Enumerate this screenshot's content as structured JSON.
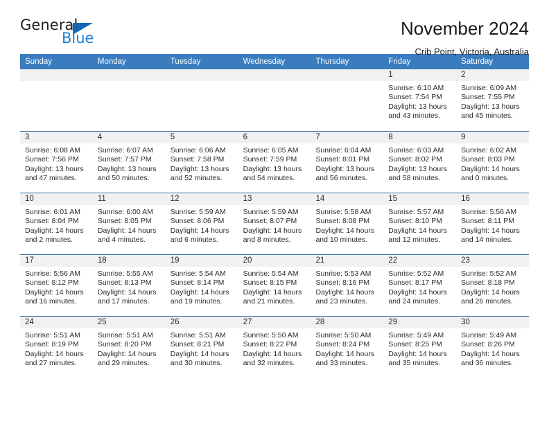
{
  "brand": {
    "name_part1": "General",
    "name_part2": "Blue",
    "triangle_color": "#1567b5",
    "blue_text_color": "#1b7fd4"
  },
  "header": {
    "title": "November 2024",
    "subtitle": "Crib Point, Victoria, Australia",
    "accent_color": "#3a7cbe"
  },
  "weekdays": [
    {
      "label": "Sunday"
    },
    {
      "label": "Monday"
    },
    {
      "label": "Tuesday"
    },
    {
      "label": "Wednesday"
    },
    {
      "label": "Thursday"
    },
    {
      "label": "Friday"
    },
    {
      "label": "Saturday"
    }
  ],
  "weeks": [
    {
      "days": [
        {
          "date": "",
          "sunrise": "",
          "sunset": "",
          "daylight": "",
          "empty": true
        },
        {
          "date": "",
          "sunrise": "",
          "sunset": "",
          "daylight": "",
          "empty": true
        },
        {
          "date": "",
          "sunrise": "",
          "sunset": "",
          "daylight": "",
          "empty": true
        },
        {
          "date": "",
          "sunrise": "",
          "sunset": "",
          "daylight": "",
          "empty": true
        },
        {
          "date": "",
          "sunrise": "",
          "sunset": "",
          "daylight": "",
          "empty": true
        },
        {
          "date": "1",
          "sunrise": "Sunrise: 6:10 AM",
          "sunset": "Sunset: 7:54 PM",
          "daylight": "Daylight: 13 hours and 43 minutes.",
          "empty": false
        },
        {
          "date": "2",
          "sunrise": "Sunrise: 6:09 AM",
          "sunset": "Sunset: 7:55 PM",
          "daylight": "Daylight: 13 hours and 45 minutes.",
          "empty": false
        }
      ]
    },
    {
      "days": [
        {
          "date": "3",
          "sunrise": "Sunrise: 6:08 AM",
          "sunset": "Sunset: 7:56 PM",
          "daylight": "Daylight: 13 hours and 47 minutes.",
          "empty": false
        },
        {
          "date": "4",
          "sunrise": "Sunrise: 6:07 AM",
          "sunset": "Sunset: 7:57 PM",
          "daylight": "Daylight: 13 hours and 50 minutes.",
          "empty": false
        },
        {
          "date": "5",
          "sunrise": "Sunrise: 6:06 AM",
          "sunset": "Sunset: 7:58 PM",
          "daylight": "Daylight: 13 hours and 52 minutes.",
          "empty": false
        },
        {
          "date": "6",
          "sunrise": "Sunrise: 6:05 AM",
          "sunset": "Sunset: 7:59 PM",
          "daylight": "Daylight: 13 hours and 54 minutes.",
          "empty": false
        },
        {
          "date": "7",
          "sunrise": "Sunrise: 6:04 AM",
          "sunset": "Sunset: 8:01 PM",
          "daylight": "Daylight: 13 hours and 56 minutes.",
          "empty": false
        },
        {
          "date": "8",
          "sunrise": "Sunrise: 6:03 AM",
          "sunset": "Sunset: 8:02 PM",
          "daylight": "Daylight: 13 hours and 58 minutes.",
          "empty": false
        },
        {
          "date": "9",
          "sunrise": "Sunrise: 6:02 AM",
          "sunset": "Sunset: 8:03 PM",
          "daylight": "Daylight: 14 hours and 0 minutes.",
          "empty": false
        }
      ]
    },
    {
      "days": [
        {
          "date": "10",
          "sunrise": "Sunrise: 6:01 AM",
          "sunset": "Sunset: 8:04 PM",
          "daylight": "Daylight: 14 hours and 2 minutes.",
          "empty": false
        },
        {
          "date": "11",
          "sunrise": "Sunrise: 6:00 AM",
          "sunset": "Sunset: 8:05 PM",
          "daylight": "Daylight: 14 hours and 4 minutes.",
          "empty": false
        },
        {
          "date": "12",
          "sunrise": "Sunrise: 5:59 AM",
          "sunset": "Sunset: 8:06 PM",
          "daylight": "Daylight: 14 hours and 6 minutes.",
          "empty": false
        },
        {
          "date": "13",
          "sunrise": "Sunrise: 5:59 AM",
          "sunset": "Sunset: 8:07 PM",
          "daylight": "Daylight: 14 hours and 8 minutes.",
          "empty": false
        },
        {
          "date": "14",
          "sunrise": "Sunrise: 5:58 AM",
          "sunset": "Sunset: 8:08 PM",
          "daylight": "Daylight: 14 hours and 10 minutes.",
          "empty": false
        },
        {
          "date": "15",
          "sunrise": "Sunrise: 5:57 AM",
          "sunset": "Sunset: 8:10 PM",
          "daylight": "Daylight: 14 hours and 12 minutes.",
          "empty": false
        },
        {
          "date": "16",
          "sunrise": "Sunrise: 5:56 AM",
          "sunset": "Sunset: 8:11 PM",
          "daylight": "Daylight: 14 hours and 14 minutes.",
          "empty": false
        }
      ]
    },
    {
      "days": [
        {
          "date": "17",
          "sunrise": "Sunrise: 5:56 AM",
          "sunset": "Sunset: 8:12 PM",
          "daylight": "Daylight: 14 hours and 16 minutes.",
          "empty": false
        },
        {
          "date": "18",
          "sunrise": "Sunrise: 5:55 AM",
          "sunset": "Sunset: 8:13 PM",
          "daylight": "Daylight: 14 hours and 17 minutes.",
          "empty": false
        },
        {
          "date": "19",
          "sunrise": "Sunrise: 5:54 AM",
          "sunset": "Sunset: 8:14 PM",
          "daylight": "Daylight: 14 hours and 19 minutes.",
          "empty": false
        },
        {
          "date": "20",
          "sunrise": "Sunrise: 5:54 AM",
          "sunset": "Sunset: 8:15 PM",
          "daylight": "Daylight: 14 hours and 21 minutes.",
          "empty": false
        },
        {
          "date": "21",
          "sunrise": "Sunrise: 5:53 AM",
          "sunset": "Sunset: 8:16 PM",
          "daylight": "Daylight: 14 hours and 23 minutes.",
          "empty": false
        },
        {
          "date": "22",
          "sunrise": "Sunrise: 5:52 AM",
          "sunset": "Sunset: 8:17 PM",
          "daylight": "Daylight: 14 hours and 24 minutes.",
          "empty": false
        },
        {
          "date": "23",
          "sunrise": "Sunrise: 5:52 AM",
          "sunset": "Sunset: 8:18 PM",
          "daylight": "Daylight: 14 hours and 26 minutes.",
          "empty": false
        }
      ]
    },
    {
      "days": [
        {
          "date": "24",
          "sunrise": "Sunrise: 5:51 AM",
          "sunset": "Sunset: 8:19 PM",
          "daylight": "Daylight: 14 hours and 27 minutes.",
          "empty": false
        },
        {
          "date": "25",
          "sunrise": "Sunrise: 5:51 AM",
          "sunset": "Sunset: 8:20 PM",
          "daylight": "Daylight: 14 hours and 29 minutes.",
          "empty": false
        },
        {
          "date": "26",
          "sunrise": "Sunrise: 5:51 AM",
          "sunset": "Sunset: 8:21 PM",
          "daylight": "Daylight: 14 hours and 30 minutes.",
          "empty": false
        },
        {
          "date": "27",
          "sunrise": "Sunrise: 5:50 AM",
          "sunset": "Sunset: 8:22 PM",
          "daylight": "Daylight: 14 hours and 32 minutes.",
          "empty": false
        },
        {
          "date": "28",
          "sunrise": "Sunrise: 5:50 AM",
          "sunset": "Sunset: 8:24 PM",
          "daylight": "Daylight: 14 hours and 33 minutes.",
          "empty": false
        },
        {
          "date": "29",
          "sunrise": "Sunrise: 5:49 AM",
          "sunset": "Sunset: 8:25 PM",
          "daylight": "Daylight: 14 hours and 35 minutes.",
          "empty": false
        },
        {
          "date": "30",
          "sunrise": "Sunrise: 5:49 AM",
          "sunset": "Sunset: 8:26 PM",
          "daylight": "Daylight: 14 hours and 36 minutes.",
          "empty": false
        }
      ]
    }
  ]
}
